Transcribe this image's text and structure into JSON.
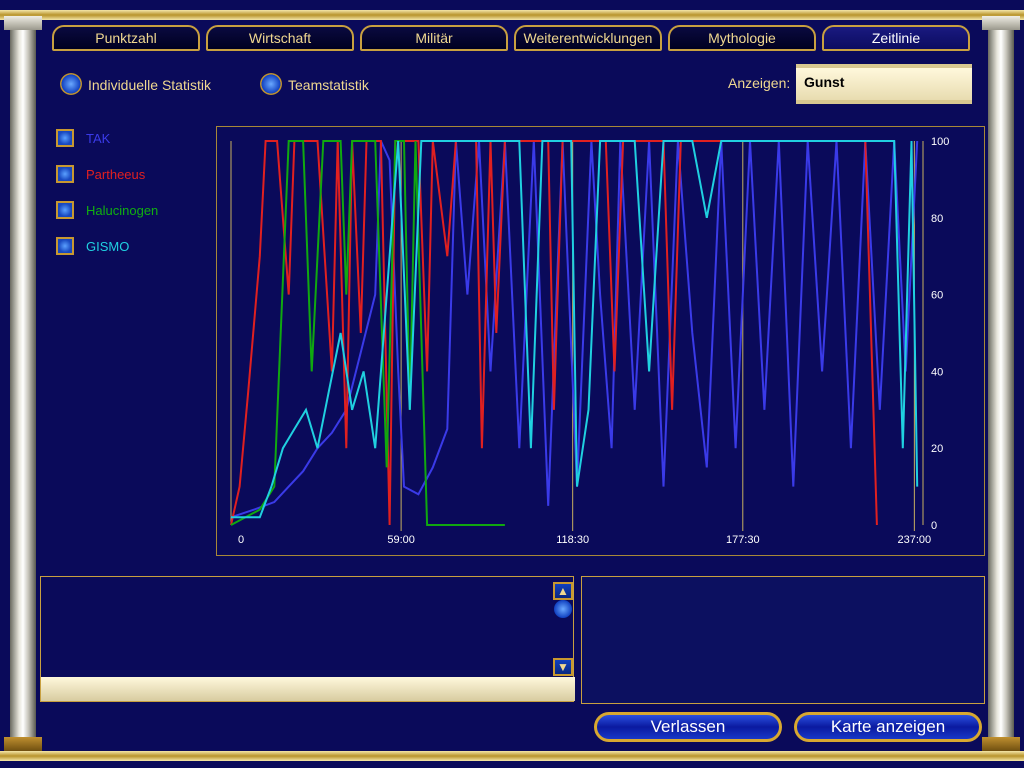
{
  "tabs": [
    {
      "label": "Punktzahl",
      "active": false
    },
    {
      "label": "Wirtschaft",
      "active": false
    },
    {
      "label": "Militär",
      "active": false
    },
    {
      "label": "Weiterentwicklungen",
      "active": false
    },
    {
      "label": "Mythologie",
      "active": false
    },
    {
      "label": "Zeitlinie",
      "active": true
    }
  ],
  "stat_options": {
    "individual": "Individuelle Statistik",
    "team": "Teamstatistik"
  },
  "display": {
    "label": "Anzeigen:",
    "value": "Gunst"
  },
  "players": [
    {
      "name": "TAK",
      "color": "#3030e0"
    },
    {
      "name": "Partheeus",
      "color": "#e02020"
    },
    {
      "name": "Halucinogen",
      "color": "#10b010"
    },
    {
      "name": "GISMO",
      "color": "#20d0e0"
    }
  ],
  "buttons": {
    "leave": "Verlassen",
    "show_map": "Karte anzeigen"
  },
  "scroll": {
    "up": "▲",
    "down": "▼"
  },
  "chart_data": {
    "type": "line",
    "x_ticks": [
      "0",
      "59:00",
      "118:30",
      "177:30",
      "237:00"
    ],
    "y_ticks": [
      "0",
      "20",
      "40",
      "60",
      "80",
      "100"
    ],
    "ylim": [
      0,
      100
    ],
    "xlim_minutes": [
      0,
      240
    ],
    "series": [
      {
        "name": "TAK",
        "color": "#3a3ae8",
        "points": [
          [
            0,
            2
          ],
          [
            8,
            4
          ],
          [
            15,
            6
          ],
          [
            20,
            10
          ],
          [
            25,
            14
          ],
          [
            30,
            20
          ],
          [
            35,
            24
          ],
          [
            40,
            30
          ],
          [
            45,
            45
          ],
          [
            50,
            60
          ],
          [
            52,
            100
          ],
          [
            55,
            95
          ],
          [
            58,
            40
          ],
          [
            60,
            10
          ],
          [
            65,
            8
          ],
          [
            70,
            15
          ],
          [
            75,
            25
          ],
          [
            78,
            100
          ],
          [
            82,
            60
          ],
          [
            86,
            100
          ],
          [
            90,
            40
          ],
          [
            95,
            100
          ],
          [
            100,
            20
          ],
          [
            105,
            100
          ],
          [
            110,
            5
          ],
          [
            115,
            100
          ],
          [
            120,
            10
          ],
          [
            125,
            100
          ],
          [
            128,
            60
          ],
          [
            132,
            20
          ],
          [
            135,
            100
          ],
          [
            140,
            30
          ],
          [
            145,
            100
          ],
          [
            150,
            10
          ],
          [
            155,
            100
          ],
          [
            160,
            50
          ],
          [
            165,
            15
          ],
          [
            170,
            100
          ],
          [
            175,
            20
          ],
          [
            180,
            100
          ],
          [
            185,
            30
          ],
          [
            190,
            100
          ],
          [
            195,
            10
          ],
          [
            200,
            100
          ],
          [
            205,
            40
          ],
          [
            210,
            100
          ],
          [
            215,
            20
          ],
          [
            220,
            100
          ],
          [
            225,
            30
          ],
          [
            230,
            100
          ],
          [
            234,
            40
          ],
          [
            238,
            100
          ]
        ]
      },
      {
        "name": "Partheeus",
        "color": "#e02020",
        "points": [
          [
            0,
            0
          ],
          [
            3,
            10
          ],
          [
            6,
            35
          ],
          [
            10,
            70
          ],
          [
            12,
            100
          ],
          [
            16,
            100
          ],
          [
            20,
            60
          ],
          [
            22,
            100
          ],
          [
            30,
            100
          ],
          [
            35,
            40
          ],
          [
            37,
            100
          ],
          [
            40,
            20
          ],
          [
            42,
            100
          ],
          [
            45,
            50
          ],
          [
            47,
            100
          ],
          [
            52,
            100
          ],
          [
            55,
            0
          ],
          [
            57,
            100
          ],
          [
            65,
            100
          ],
          [
            68,
            40
          ],
          [
            70,
            100
          ],
          [
            75,
            70
          ],
          [
            78,
            100
          ],
          [
            85,
            100
          ],
          [
            87,
            20
          ],
          [
            90,
            100
          ],
          [
            92,
            50
          ],
          [
            95,
            100
          ],
          [
            110,
            100
          ],
          [
            112,
            30
          ],
          [
            115,
            100
          ],
          [
            130,
            100
          ],
          [
            133,
            40
          ],
          [
            136,
            100
          ],
          [
            150,
            100
          ],
          [
            153,
            30
          ],
          [
            156,
            100
          ],
          [
            160,
            100
          ],
          [
            220,
            100
          ],
          [
            224,
            0
          ]
        ]
      },
      {
        "name": "Halucinogen",
        "color": "#10a810",
        "points": [
          [
            0,
            0
          ],
          [
            10,
            4
          ],
          [
            15,
            10
          ],
          [
            20,
            100
          ],
          [
            25,
            100
          ],
          [
            28,
            40
          ],
          [
            32,
            100
          ],
          [
            38,
            100
          ],
          [
            40,
            60
          ],
          [
            42,
            100
          ],
          [
            50,
            100
          ],
          [
            54,
            15
          ],
          [
            57,
            100
          ],
          [
            60,
            100
          ],
          [
            62,
            30
          ],
          [
            64,
            100
          ],
          [
            68,
            0
          ],
          [
            95,
            0
          ]
        ]
      },
      {
        "name": "GISMO",
        "color": "#20d0e0",
        "points": [
          [
            0,
            2
          ],
          [
            10,
            2
          ],
          [
            14,
            10
          ],
          [
            18,
            20
          ],
          [
            22,
            25
          ],
          [
            26,
            30
          ],
          [
            30,
            20
          ],
          [
            34,
            35
          ],
          [
            38,
            50
          ],
          [
            42,
            30
          ],
          [
            46,
            40
          ],
          [
            50,
            20
          ],
          [
            55,
            70
          ],
          [
            58,
            100
          ],
          [
            62,
            30
          ],
          [
            66,
            100
          ],
          [
            70,
            100
          ],
          [
            100,
            100
          ],
          [
            104,
            20
          ],
          [
            108,
            100
          ],
          [
            112,
            100
          ],
          [
            118,
            100
          ],
          [
            120,
            10
          ],
          [
            124,
            30
          ],
          [
            128,
            100
          ],
          [
            140,
            100
          ],
          [
            145,
            40
          ],
          [
            150,
            100
          ],
          [
            160,
            100
          ],
          [
            165,
            80
          ],
          [
            170,
            100
          ],
          [
            230,
            100
          ],
          [
            233,
            20
          ],
          [
            236,
            100
          ],
          [
            238,
            10
          ]
        ]
      }
    ]
  }
}
